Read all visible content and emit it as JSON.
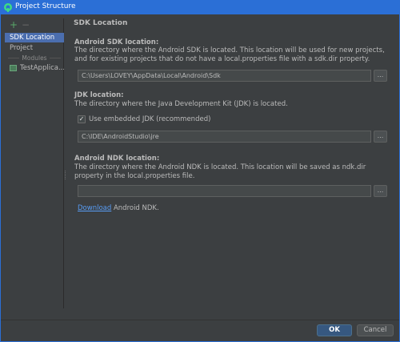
{
  "window": {
    "title": "Project Structure",
    "app_icon": "android-studio-icon"
  },
  "sidebar": {
    "add_icon": "+",
    "remove_icon": "−",
    "items": [
      {
        "label": "SDK Location",
        "selected": true
      },
      {
        "label": "Project",
        "selected": false
      }
    ],
    "modules_header": "Modules",
    "modules": [
      {
        "label": "TestApplica...",
        "icon": "module-folder-icon"
      }
    ]
  },
  "main": {
    "page_title": "SDK Location",
    "android_sdk": {
      "title": "Android SDK location:",
      "description": "The directory where the Android SDK is located. This location will be used for new projects, and for existing projects that do not have a local.properties file with a sdk.dir property.",
      "path": "C:\\Users\\LOVEY\\AppData\\Local\\Android\\Sdk",
      "browse_label": "..."
    },
    "jdk": {
      "title": "JDK location:",
      "description": "The directory where the Java Development Kit (JDK) is located.",
      "embedded_label": "Use embedded JDK (recommended)",
      "embedded_checked": true,
      "path": "C:\\IDE\\AndroidStudio\\jre",
      "browse_label": "..."
    },
    "android_ndk": {
      "title": "Android NDK location:",
      "description": "The directory where the Android NDK is located. This location will be saved as ndk.dir property in the local.properties file.",
      "path": "",
      "browse_label": "...",
      "download_link": "Download",
      "download_suffix": " Android NDK."
    }
  },
  "footer": {
    "ok_label": "OK",
    "cancel_label": "Cancel"
  },
  "colors": {
    "titlebar": "#2b6fd6",
    "background": "#3c3f41",
    "selection": "#4b6eaf",
    "link": "#589df6",
    "ok_button": "#365880"
  }
}
